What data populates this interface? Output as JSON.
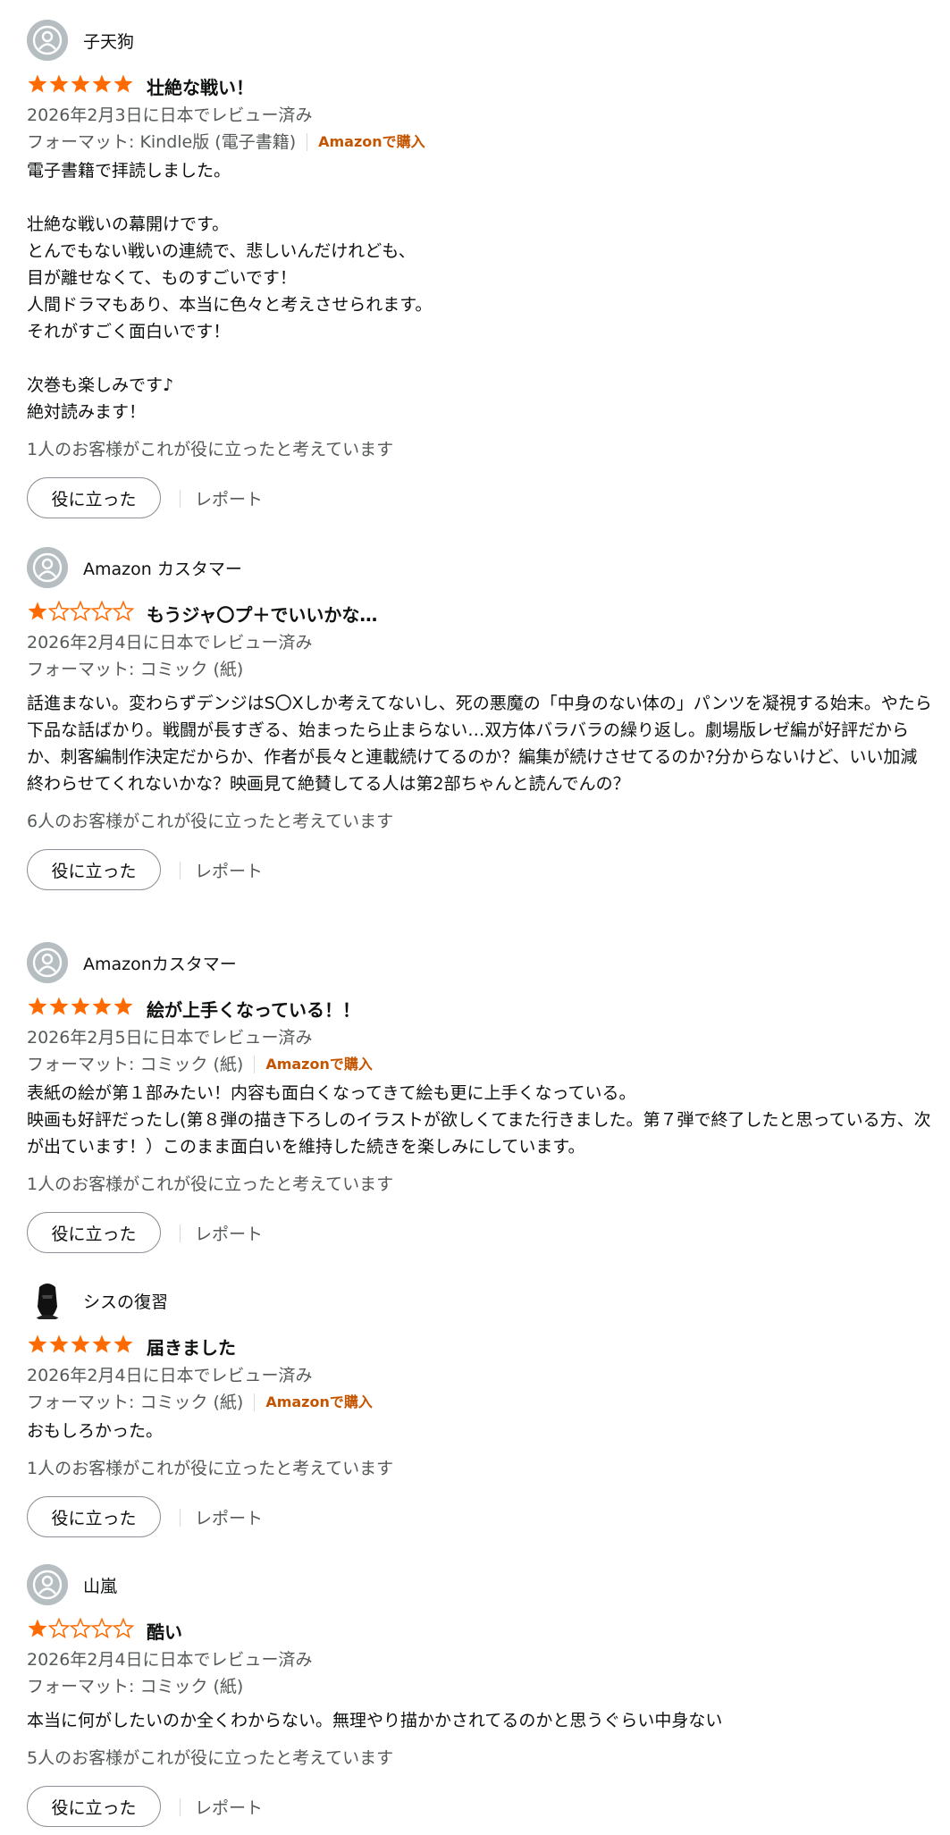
{
  "colors": {
    "star_filled": "#ff6a00",
    "verified": "#c45500",
    "muted": "#565959"
  },
  "reviews": [
    {
      "name": "子天狗",
      "avatar": "default-avatar",
      "stars": 5,
      "title": "壮絶な戦い！",
      "date": "2026年2月3日に日本でレビュー済み",
      "format": "フォーマット: Kindle版 (電子書籍)",
      "verified": "Amazonで購入",
      "body": "電子書籍で拝読しました。\n\n壮絶な戦いの幕開けです。\nとんでもない戦いの連続で、悲しいんだけれども、\n目が離せなくて、ものすごいです！\n人間ドラマもあり、本当に色々と考えさせられます。\nそれがすごく面白いです！\n\n次巻も楽しみです♪\n絶対読みます！",
      "helpful": "1人のお客様がこれが役に立ったと考えています",
      "helpful_button": "役に立った",
      "report": "レポート"
    },
    {
      "name": "Amazon カスタマー",
      "avatar": "default-avatar",
      "stars": 1,
      "title": "もうジャ〇プ＋でいいかな…",
      "date": "2026年2月4日に日本でレビュー済み",
      "format": "フォーマット: コミック (紙)",
      "verified": "",
      "body": "話進まない。変わらずデンジはS〇Xしか考えてないし、死の悪魔の「中身のない体の」パンツを凝視する始末。やたら下品な話ばかり。戦闘が長すぎる、始まったら止まらない…双方体バラバラの繰り返し。劇場版レゼ編が好評だからか、刺客編制作決定だからか、作者が長々と連載続けてるのか？編集が続けさせてるのか?分からないけど、いい加減終わらせてくれないかな？映画見て絶賛してる人は第2部ちゃんと読んでんの？",
      "helpful": "6人のお客様がこれが役に立ったと考えています",
      "helpful_button": "役に立った",
      "report": "レポート"
    },
    {
      "name": "Amazonカスタマー",
      "avatar": "default-avatar",
      "stars": 5,
      "title": "絵が上手くなっている！！",
      "date": "2026年2月5日に日本でレビュー済み",
      "format": "フォーマット: コミック (紙)",
      "verified": "Amazonで購入",
      "body": "表紙の絵が第１部みたい！内容も面白くなってきて絵も更に上手くなっている。\n映画も好評だったし(第８弾の描き下ろしのイラストが欲しくてまた行きました。第７弾で終了したと思っている方、次が出ています！）このまま面白いを維持した続きを楽しみにしています。",
      "helpful": "1人のお客様がこれが役に立ったと考えています",
      "helpful_button": "役に立った",
      "report": "レポート"
    },
    {
      "name": "シスの復習",
      "avatar": "custom-avatar",
      "stars": 5,
      "title": "届きました",
      "date": "2026年2月4日に日本でレビュー済み",
      "format": "フォーマット: コミック (紙)",
      "verified": "Amazonで購入",
      "body": "おもしろかった。",
      "helpful": "1人のお客様がこれが役に立ったと考えています",
      "helpful_button": "役に立った",
      "report": "レポート"
    },
    {
      "name": "山嵐",
      "avatar": "default-avatar",
      "stars": 1,
      "title": "酷い",
      "date": "2026年2月4日に日本でレビュー済み",
      "format": "フォーマット: コミック (紙)",
      "verified": "",
      "body": "本当に何がしたいのか全くわからない。無理やり描かかされてるのかと思うぐらい中身ない",
      "helpful": "5人のお客様がこれが役に立ったと考えています",
      "helpful_button": "役に立った",
      "report": "レポート"
    }
  ]
}
